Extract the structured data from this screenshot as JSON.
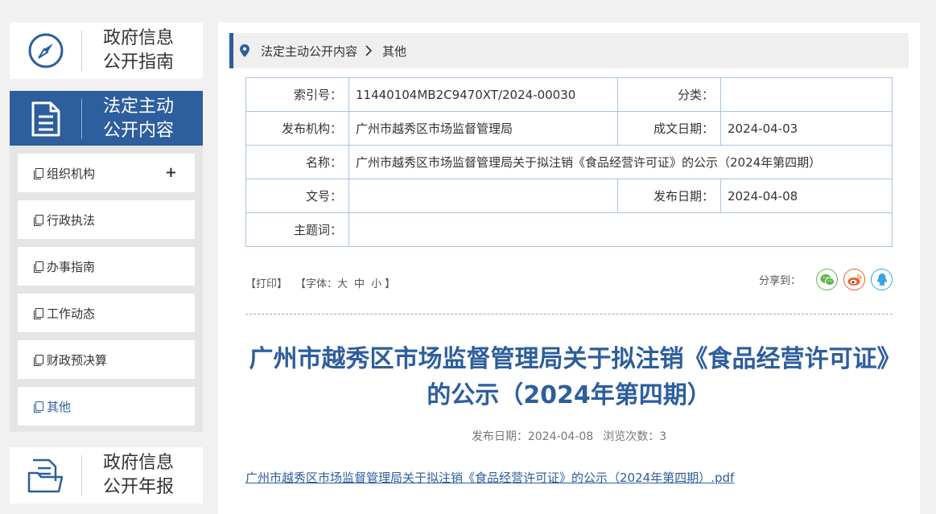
{
  "sidebar": {
    "guide": {
      "line1": "政府信息",
      "line2": "公开指南"
    },
    "active": {
      "line1": "法定主动",
      "line2": "公开内容"
    },
    "menu": [
      {
        "label": "组织机构"
      },
      {
        "label": "行政执法"
      },
      {
        "label": "办事指南"
      },
      {
        "label": "工作动态"
      },
      {
        "label": "财政预决算"
      },
      {
        "label": "其他"
      }
    ],
    "menu_expand_symbol": "+",
    "annual": {
      "line1": "政府信息",
      "line2": "公开年报"
    }
  },
  "breadcrumb": {
    "items": [
      "法定主动公开内容",
      "其他"
    ]
  },
  "meta": {
    "index_label": "索引号：",
    "index_value": "11440104MB2C9470XT/2024-00030",
    "category_label": "分类：",
    "category_value": "",
    "publisher_label": "发布机构：",
    "publisher_value": "广州市越秀区市场监督管理局",
    "created_label": "成文日期：",
    "created_value": "2024-04-03",
    "name_label": "名称：",
    "name_value": "广州市越秀区市场监督管理局关于拟注销《食品经营许可证》的公示（2024年第四期）",
    "docno_label": "文号：",
    "docno_value": "",
    "published_label": "发布日期：",
    "published_value": "2024-04-08",
    "subject_label": "主题词：",
    "subject_value": ""
  },
  "tools": {
    "print": "【打印】",
    "font_prefix": "【字体：",
    "font_large": "大",
    "font_medium": "中",
    "font_small": "小",
    "font_suffix": "】",
    "share_label": "分享到："
  },
  "article": {
    "title": "广州市越秀区市场监督管理局关于拟注销《食品经营许可证》的公示（2024年第四期）",
    "pub_date": "发布日期：2024-04-08",
    "views": "浏览次数：3",
    "attachment": "广州市越秀区市场监督管理局关于拟注销《食品经营许可证》的公示（2024年第四期）.pdf"
  },
  "colors": {
    "accent": "#2d5e9d",
    "wechat": "#5fb646",
    "weibo": "#e6602d",
    "qq": "#3aa3e3"
  }
}
